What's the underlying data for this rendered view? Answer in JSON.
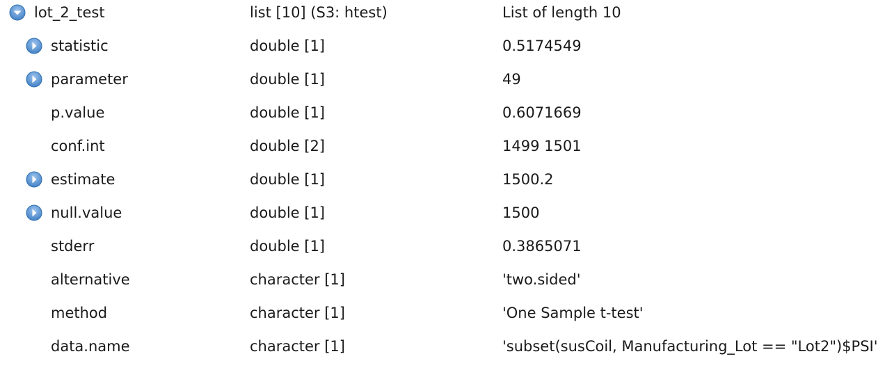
{
  "root": {
    "name": "lot_2_test",
    "type": "list [10] (S3: htest)",
    "value": "List of length 10",
    "expanded": true
  },
  "children": [
    {
      "name": "statistic",
      "type": "double [1]",
      "value": "0.5174549",
      "expandable": true
    },
    {
      "name": "parameter",
      "type": "double [1]",
      "value": "49",
      "expandable": true
    },
    {
      "name": "p.value",
      "type": "double [1]",
      "value": "0.6071669",
      "expandable": false
    },
    {
      "name": "conf.int",
      "type": "double [2]",
      "value": "1499 1501",
      "expandable": false
    },
    {
      "name": "estimate",
      "type": "double [1]",
      "value": "1500.2",
      "expandable": true
    },
    {
      "name": "null.value",
      "type": "double [1]",
      "value": "1500",
      "expandable": true
    },
    {
      "name": "stderr",
      "type": "double [1]",
      "value": "0.3865071",
      "expandable": false
    },
    {
      "name": "alternative",
      "type": "character [1]",
      "value": "'two.sided'",
      "expandable": false
    },
    {
      "name": "method",
      "type": "character [1]",
      "value": "'One Sample t-test'",
      "expandable": false
    },
    {
      "name": "data.name",
      "type": "character [1]",
      "value": "'subset(susCoil, Manufacturing_Lot == \"Lot2\")$PSI'",
      "expandable": false
    }
  ],
  "colors": {
    "toggle_fill": "#5b9bd5",
    "toggle_border": "#2e6fb0",
    "text": "#1a1a1a"
  },
  "icons": {
    "expanded": "chevron-down-circle-icon",
    "collapsed": "chevron-right-circle-icon"
  }
}
